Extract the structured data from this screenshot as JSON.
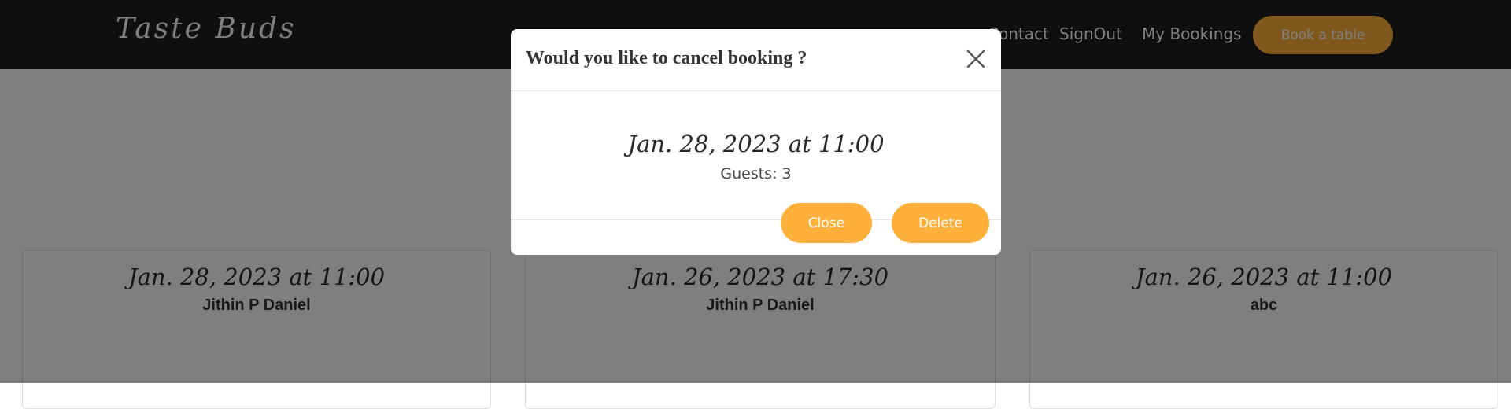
{
  "navbar": {
    "brand": "Taste Buds",
    "links": {
      "contact": "Contact",
      "signout": "SignOut",
      "bookings": "My Bookings"
    },
    "book_button": "Book a table"
  },
  "bookings": [
    {
      "date": "Jan. 28, 2023 at 11:00",
      "name": "Jithin P Daniel"
    },
    {
      "date": "Jan. 26, 2023 at 17:30",
      "name": "Jithin P Daniel"
    },
    {
      "date": "Jan. 26, 2023 at 11:00",
      "name": "abc"
    }
  ],
  "modal": {
    "title": "Would you like to cancel booking ?",
    "date": "Jan. 28, 2023 at 11:00",
    "guests": "Guests: 3",
    "close_button": "Close",
    "delete_button": "Delete",
    "close_icon": "close-icon"
  },
  "colors": {
    "accent": "#ffb03b",
    "navbar": "#1f1f1f",
    "overlay": "rgba(0,0,0,0.5)"
  }
}
